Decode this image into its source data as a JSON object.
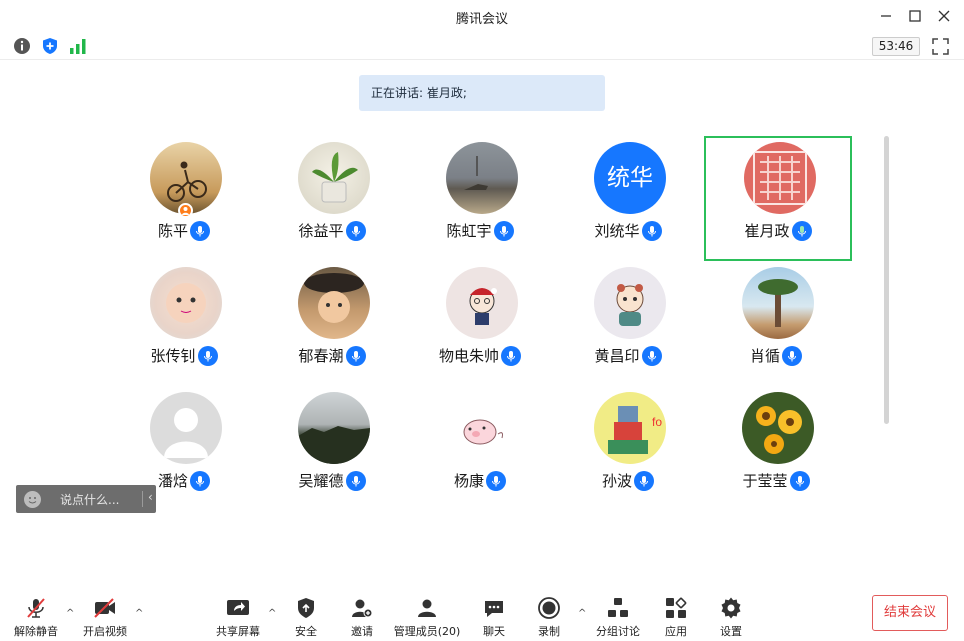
{
  "window": {
    "title": "腾讯会议"
  },
  "timer": "53:46",
  "speaking_text": "正在讲话: 崔月政;",
  "participants": [
    {
      "name": "陈平",
      "host": true
    },
    {
      "name": "徐益平"
    },
    {
      "name": "陈虹宇"
    },
    {
      "name": "刘统华",
      "avatar_text": "统华"
    },
    {
      "name": "崔月政",
      "speaking": true
    },
    {
      "name": "张传钊"
    },
    {
      "name": "郁春潮"
    },
    {
      "name": "物电朱帅"
    },
    {
      "name": "黄昌印"
    },
    {
      "name": "肖循"
    },
    {
      "name": "潘焓"
    },
    {
      "name": "吴耀德"
    },
    {
      "name": "杨康"
    },
    {
      "name": "孙波"
    },
    {
      "name": "于莹莹"
    }
  ],
  "chat": {
    "placeholder": "说点什么..."
  },
  "toolbar": {
    "unmute": "解除静音",
    "video": "开启视频",
    "share": "共享屏幕",
    "security": "安全",
    "invite": "邀请",
    "members": "管理成员(20)",
    "chat": "聊天",
    "record": "录制",
    "breakout": "分组讨论",
    "apps": "应用",
    "settings": "设置",
    "end": "结束会议"
  },
  "colors": {
    "accent": "#1677ff",
    "active_border": "#2bbf5a",
    "danger": "#e03b3b"
  }
}
